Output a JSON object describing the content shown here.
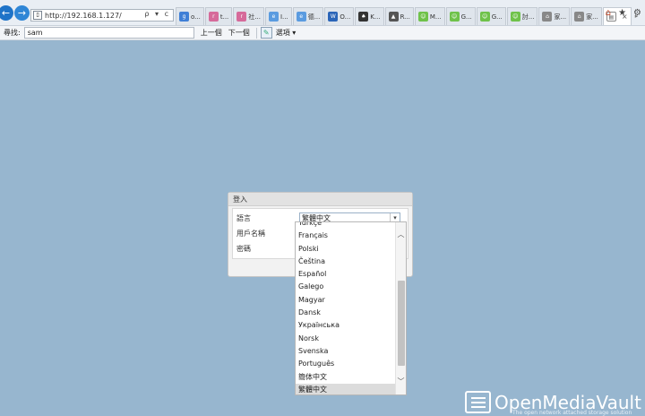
{
  "browser": {
    "back_icon": "back-arrow-icon",
    "forward_icon": "forward-arrow-icon",
    "address": "http://192.168.1.127/",
    "address_tools": "ρ ▾ c",
    "tabs": [
      {
        "label": "o...",
        "color": "#3f7fd6",
        "glyph": "g"
      },
      {
        "label": "t...",
        "color": "#d66a9a",
        "glyph": "r"
      },
      {
        "label": "社...",
        "color": "#d66a9a",
        "glyph": "r"
      },
      {
        "label": "I...",
        "color": "#5a9be0",
        "glyph": "e"
      },
      {
        "label": "德...",
        "color": "#5a9be0",
        "glyph": "e"
      },
      {
        "label": "O...",
        "color": "#2b65b8",
        "glyph": "W"
      },
      {
        "label": "K...",
        "color": "#333333",
        "glyph": "♠"
      },
      {
        "label": "R...",
        "color": "#555555",
        "glyph": "▲"
      },
      {
        "label": "M...",
        "color": "#6fc24a",
        "glyph": "☺"
      },
      {
        "label": "G...",
        "color": "#6fc24a",
        "glyph": "☺"
      },
      {
        "label": "G...",
        "color": "#6fc24a",
        "glyph": "☺"
      },
      {
        "label": "討...",
        "color": "#6fc24a",
        "glyph": "☺"
      },
      {
        "label": "家...",
        "color": "#888888",
        "glyph": "⌂"
      },
      {
        "label": "家...",
        "color": "#888888",
        "glyph": "⌂"
      }
    ],
    "active_tab_close": "×",
    "tab_arrow": "▸",
    "right_icons": [
      "⌂",
      "★",
      "⚙"
    ]
  },
  "find_bar": {
    "label": "尋找:",
    "query": "sam",
    "prev": "上一個",
    "next": "下一個",
    "options": "選項 ▾"
  },
  "login": {
    "title": "登入",
    "language_label": "語言",
    "username_label": "用戶名稱",
    "password_label": "密碼",
    "language_value": "繁體中文",
    "caret": "▾"
  },
  "language_options": [
    "Türkçe",
    "Français",
    "Polski",
    "Čeština",
    "Español",
    "Galego",
    "Magyar",
    "Dansk",
    "Українська",
    "Norsk",
    "Svenska",
    "Português",
    "簡体中文",
    "繁體中文"
  ],
  "selected_language_index": 13,
  "brand": {
    "name": "OpenMediaVault",
    "tagline": "The open network attached storage solution"
  }
}
